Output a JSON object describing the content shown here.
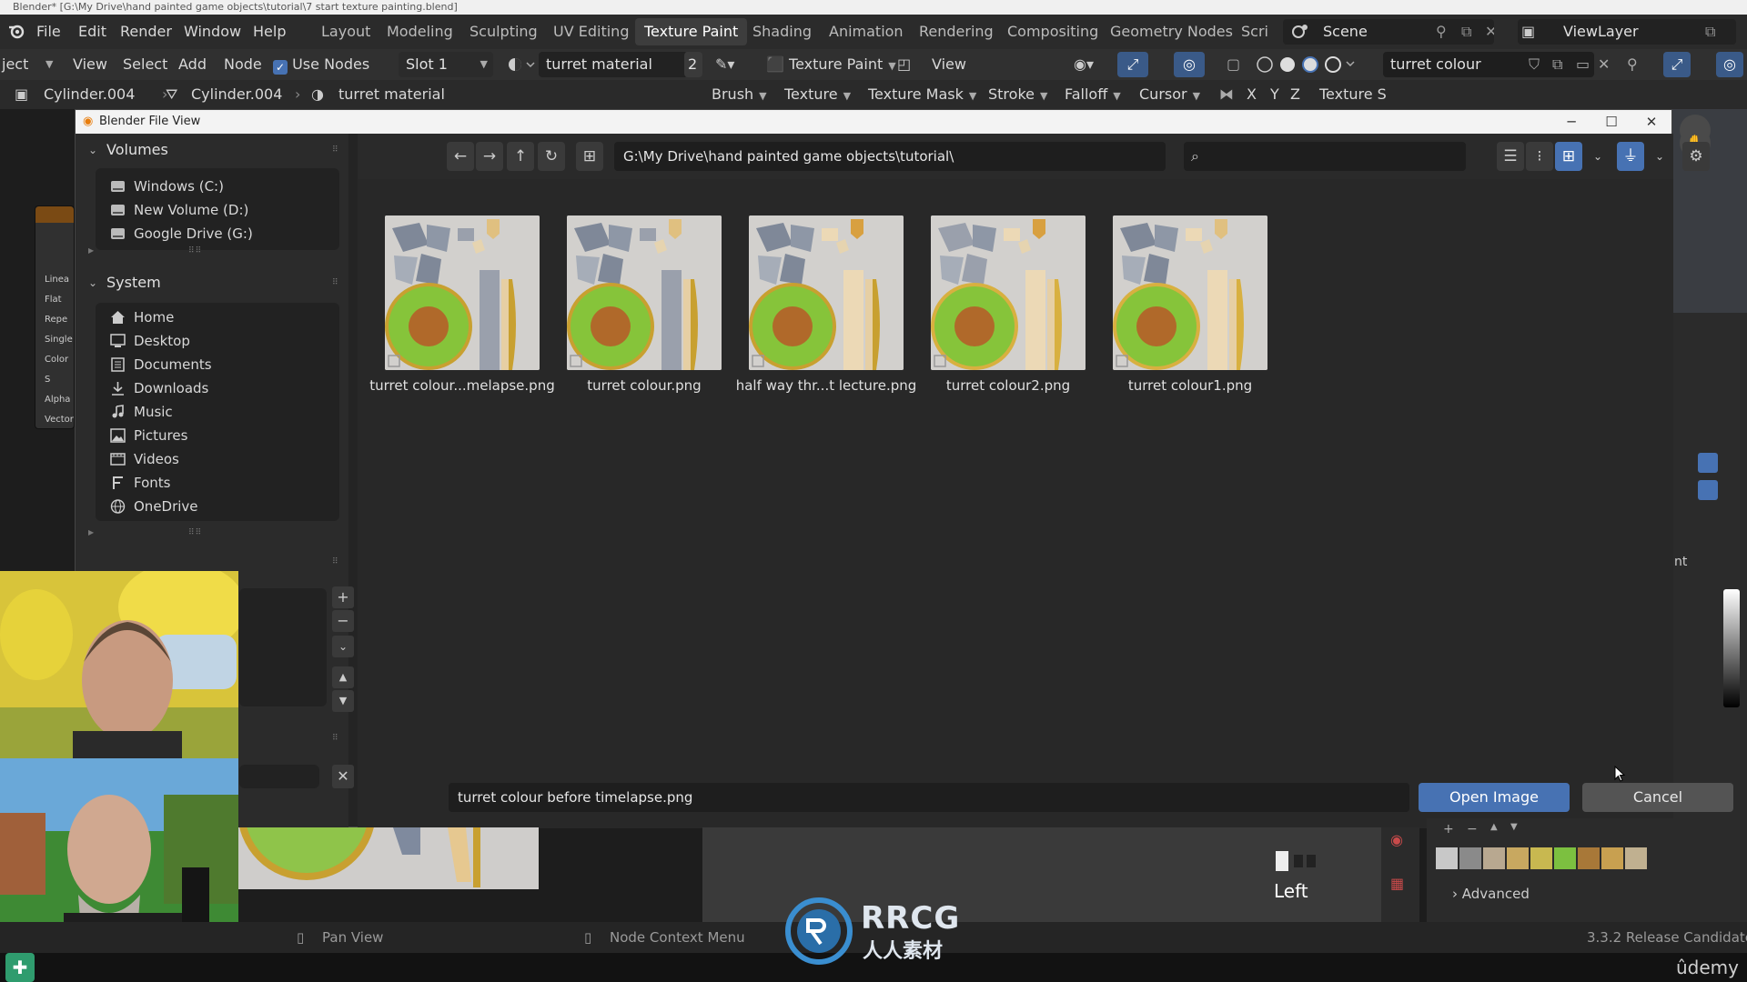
{
  "window_title": "Blender* [G:\\My Drive\\hand painted game objects\\tutorial\\7 start texture painting.blend]",
  "menu": [
    "File",
    "Edit",
    "Render",
    "Window",
    "Help"
  ],
  "workspaces": [
    "Layout",
    "Modeling",
    "Sculpting",
    "UV Editing",
    "Texture Paint",
    "Shading",
    "Animation",
    "Rendering",
    "Compositing",
    "Geometry Nodes",
    "Scri"
  ],
  "active_workspace": "Texture Paint",
  "scene_label": "Scene",
  "viewlayer_label": "ViewLayer",
  "node_editor": {
    "object_menu": "ject",
    "view": "View",
    "select": "Select",
    "add": "Add",
    "node": "Node",
    "use_nodes": "Use Nodes",
    "slot": "Slot 1",
    "material": "turret material",
    "users": "2",
    "breadcrumb": [
      "Cylinder.004",
      "Cylinder.004",
      "turret material"
    ]
  },
  "viewport": {
    "mode": "Texture Paint",
    "view": "View",
    "image_name": "turret colour",
    "menus": [
      "Brush",
      "Texture",
      "Texture Mask",
      "Stroke",
      "Falloff",
      "Cursor"
    ],
    "axes": [
      "X",
      "Y",
      "Z"
    ],
    "texture_slots": "Texture S",
    "view_label": "Left"
  },
  "dialog": {
    "title": "Blender File View",
    "path": "G:\\My Drive\\hand painted game objects\\tutorial\\",
    "volumes_header": "Volumes",
    "volumes": [
      "Windows (C:)",
      "New Volume (D:)",
      "Google Drive (G:)"
    ],
    "system_header": "System",
    "system": [
      "Home",
      "Desktop",
      "Documents",
      "Downloads",
      "Music",
      "Pictures",
      "Videos",
      "Fonts",
      "OneDrive"
    ],
    "files": [
      {
        "name": "turret colour...melapse.png",
        "variant": "a"
      },
      {
        "name": "turret colour.png",
        "variant": "a"
      },
      {
        "name": "half way thr...t lecture.png",
        "variant": "b"
      },
      {
        "name": "turret colour2.png",
        "variant": "c"
      },
      {
        "name": "turret colour1.png",
        "variant": "d"
      }
    ],
    "filename": "turret colour before timelapse.png",
    "open_label": "Open Image",
    "cancel_label": "Cancel"
  },
  "side_panel": {
    "ent": "nt",
    "advanced": "Advanced",
    "palette": [
      "#c8c8c8",
      "#8a8a8a",
      "#b8a890",
      "#c8a860",
      "#c8b850",
      "#7cc040",
      "#a87838",
      "#c8a050",
      "#c0b090"
    ]
  },
  "node_labels": [
    "Linea",
    "Flat",
    "Repe",
    "Single",
    "Color S",
    "Alpha",
    "Vector"
  ],
  "status": {
    "pan": "Pan View",
    "context": "Node Context Menu",
    "version": "3.3.2 Release Candidate"
  },
  "watermark": "RRCG",
  "watermark_sub": "人人素材",
  "udemy": "ûdemy"
}
